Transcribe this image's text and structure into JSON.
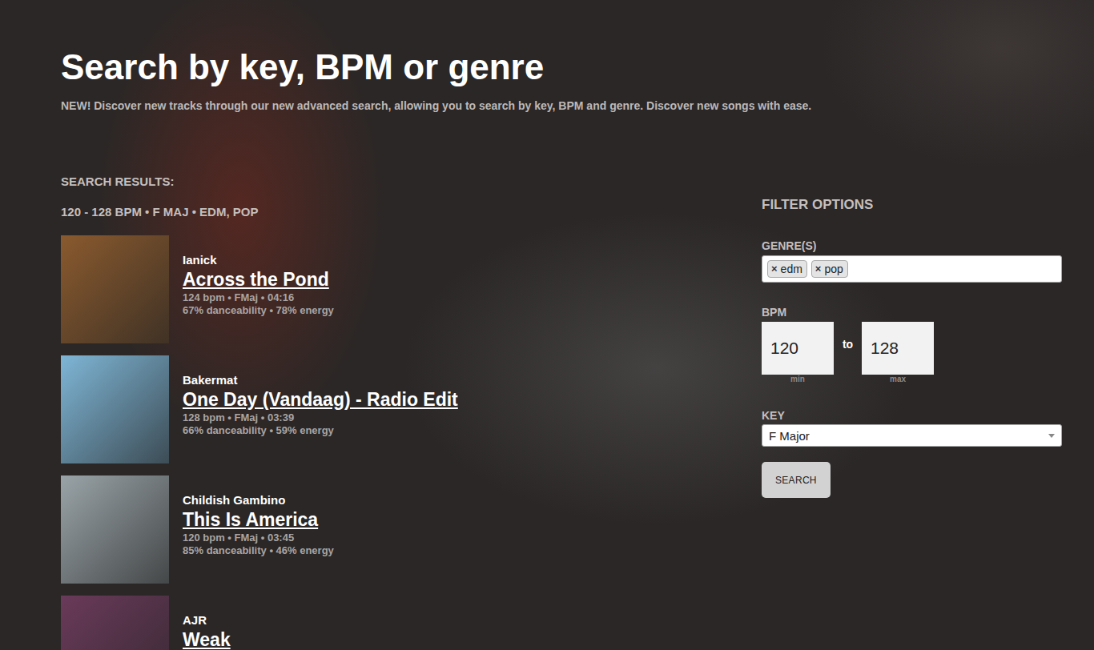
{
  "page": {
    "title": "Search by key, BPM or genre",
    "subtitle": "NEW! Discover new tracks through our new advanced search, allowing you to search by key, BPM and genre. Discover new songs with ease."
  },
  "results": {
    "heading": "SEARCH RESULTS:",
    "summary": "120 - 128 BPM • F MAJ • EDM, POP",
    "tracks": [
      {
        "artist": "Ianick",
        "title": "Across the Pond",
        "meta": "124 bpm • FMaj • 04:16",
        "stats": "67% danceability • 78% energy",
        "color": "#8a5a2e"
      },
      {
        "artist": "Bakermat",
        "title": "One Day (Vandaag) - Radio Edit",
        "meta": "128 bpm • FMaj • 03:39",
        "stats": "66% danceability • 59% energy",
        "color": "#7fb6d6"
      },
      {
        "artist": "Childish Gambino",
        "title": "This Is America",
        "meta": "120 bpm • FMaj • 03:45",
        "stats": "85% danceability • 46% energy",
        "color": "#9aa4a8"
      },
      {
        "artist": "AJR",
        "title": "Weak",
        "meta": "",
        "stats": "",
        "color": "#6a3a5a"
      }
    ]
  },
  "filters": {
    "heading": "FILTER OPTIONS",
    "genre": {
      "label": "GENRE(S)",
      "chips": [
        {
          "remove": "×",
          "label": "edm"
        },
        {
          "remove": "×",
          "label": "pop"
        }
      ]
    },
    "bpm": {
      "label": "BPM",
      "min": "120",
      "max": "128",
      "separator": "to",
      "min_label": "min",
      "max_label": "max"
    },
    "key": {
      "label": "KEY",
      "value": "F Major"
    },
    "button": "SEARCH"
  }
}
